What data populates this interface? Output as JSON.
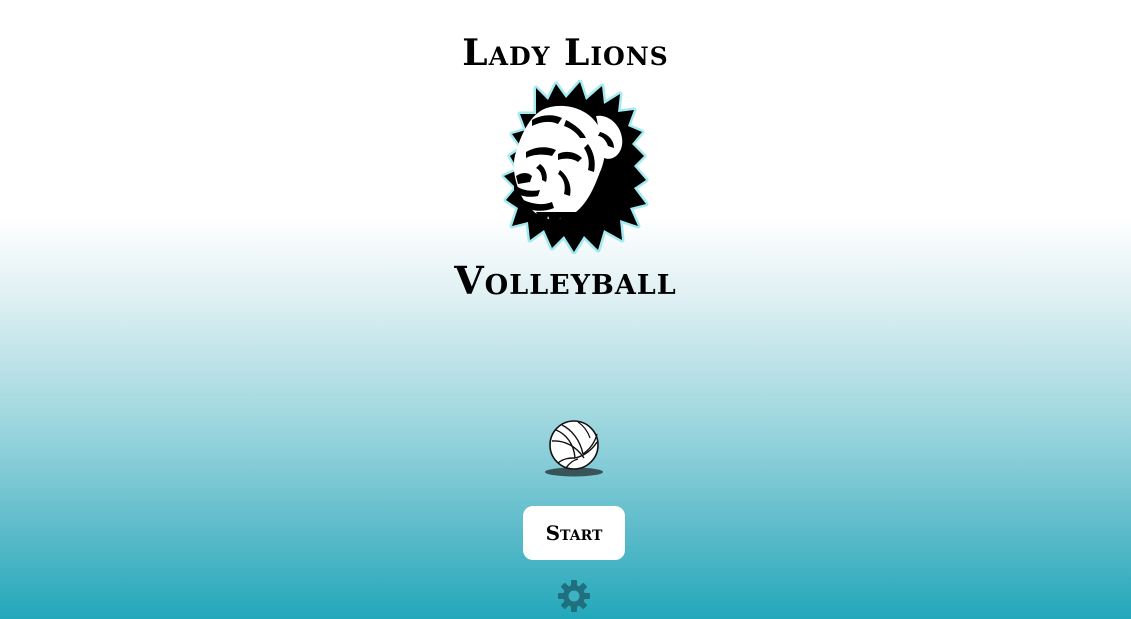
{
  "header": {
    "title": "Lady Lions",
    "subtitle": "Volleyball"
  },
  "menu": {
    "start_label": "Start"
  },
  "icons": {
    "logo": "lion-head-icon",
    "ball": "volleyball-icon",
    "settings": "gear-icon"
  },
  "colors": {
    "gradient_top": "#ffffff",
    "gradient_bottom": "#22a8ba",
    "gear": "#1f6f7f",
    "logo_glow": "#4fd3e0"
  }
}
